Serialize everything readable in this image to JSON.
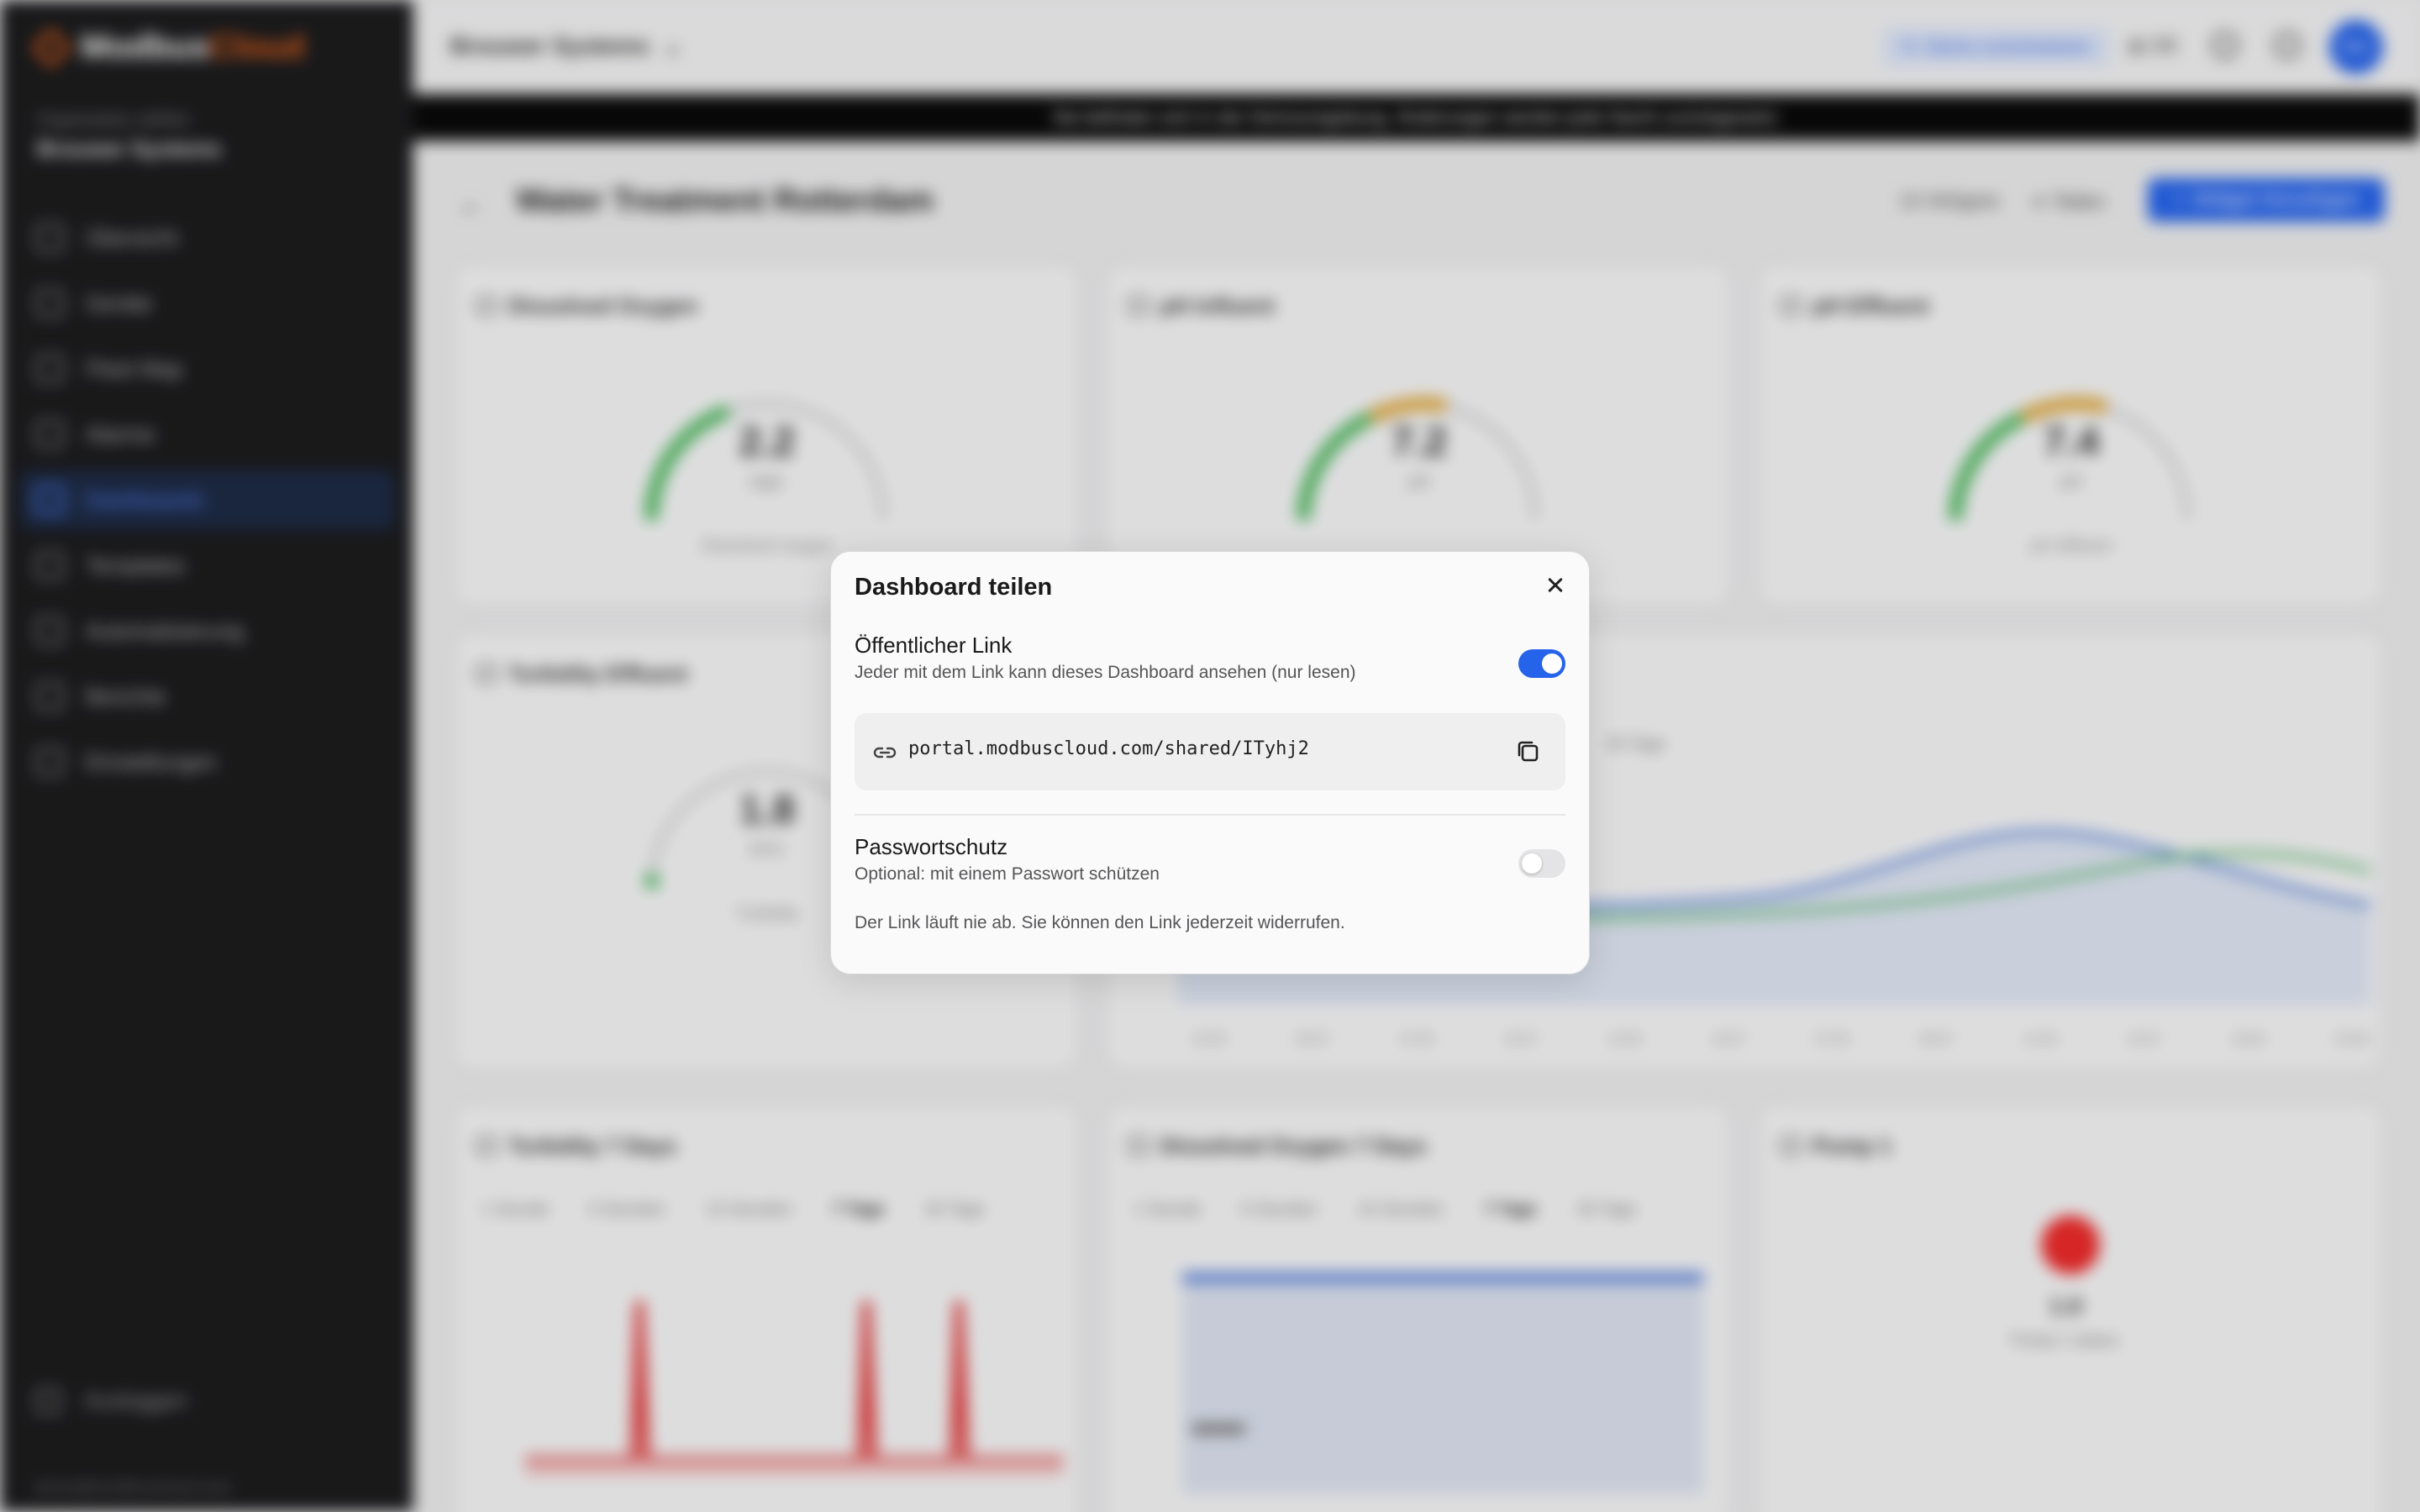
{
  "app": {
    "logo_word1": "Modbus",
    "logo_word2": "Cloud",
    "org_label": "Organisation wählen",
    "org_name": "Brouwer Systems",
    "nav": [
      {
        "label": "Übersicht",
        "icon": "grid-icon"
      },
      {
        "label": "Geräte",
        "icon": "device-icon"
      },
      {
        "label": "Fleet Map",
        "icon": "map-icon"
      },
      {
        "label": "Alarme",
        "icon": "bell-icon"
      },
      {
        "label": "Dashboards",
        "icon": "chart-icon",
        "active": true
      },
      {
        "label": "Templates",
        "icon": "template-icon"
      },
      {
        "label": "Automatisierung",
        "icon": "bolt-icon"
      },
      {
        "label": "Berichte",
        "icon": "report-icon"
      },
      {
        "label": "Einstellungen",
        "icon": "gear-icon"
      }
    ],
    "logout": "Ausloggen",
    "user_email": "demo@modbuscloud.com"
  },
  "topbar": {
    "breadcrumb": "Brouwer Systems",
    "demo_badge": "Demo zurücksetzen",
    "language": "DE",
    "avatar_initials": "DU"
  },
  "banner": {
    "text": "Sie befinden sich in der Demoumgebung. Änderungen werden jede Nacht zurückgesetzt."
  },
  "page": {
    "title": "Water Treatment Rotterdam",
    "widget_count": "10 Widgets",
    "share_label": "Teilen",
    "add_widget": "Widget hinzufügen"
  },
  "widgets": {
    "gauge1": {
      "title": "Dissolved Oxygen",
      "value": "2.2",
      "unit": "mg/L",
      "sub": "Dissolved oxygen",
      "level": 0.22
    },
    "gauge2": {
      "title": "pH Influent",
      "value": "7.2",
      "unit": "pH",
      "sub": "pH influent",
      "level": 0.6
    },
    "gauge3": {
      "title": "pH Effluent",
      "value": "7.4",
      "unit": "pH",
      "sub": "pH effluent",
      "level": 0.62
    },
    "gauge4": {
      "title": "Turbidity Effluent",
      "value": "1.8",
      "unit": "NTU",
      "sub": "Turbidity",
      "level": 0.04
    },
    "line_tab": "30 Tage",
    "line_ticks": [
      "22:00",
      "00:07",
      "07:00",
      "10:07",
      "14:00",
      "18:07",
      "07:00",
      "08:07",
      "12:00",
      "15:07",
      "18:00",
      "20:00"
    ],
    "chart1": {
      "title": "Turbidity 7 Days",
      "tabs": [
        "1 Stunde",
        "6 Stunden",
        "24 Stunden",
        "7 Tage",
        "30 Tage"
      ],
      "selected": "7 Tage"
    },
    "chart2": {
      "title": "Dissolved Oxygen 7 Days",
      "tabs": [
        "1 Stunde",
        "6 Stunden",
        "24 Stunden",
        "7 Tage",
        "30 Tage"
      ],
      "selected": "7 Tage"
    },
    "status": {
      "title": "Pump 1",
      "value": "1.0",
      "label": "Pump 1 status",
      "color": "#ef2b2b"
    }
  },
  "modal": {
    "title": "Dashboard teilen",
    "public_link_label": "Öffentlicher Link",
    "public_link_desc": "Jeder mit dem Link kann dieses Dashboard ansehen (nur lesen)",
    "public_link_enabled": true,
    "url": "portal.modbuscloud.com/shared/ITyhj2",
    "password_label": "Passwortschutz",
    "password_desc": "Optional: mit einem Passwort schützen",
    "password_enabled": false,
    "note": "Der Link läuft nie ab. Sie können den Link jederzeit widerrufen.",
    "accent_color": "#2563eb"
  }
}
